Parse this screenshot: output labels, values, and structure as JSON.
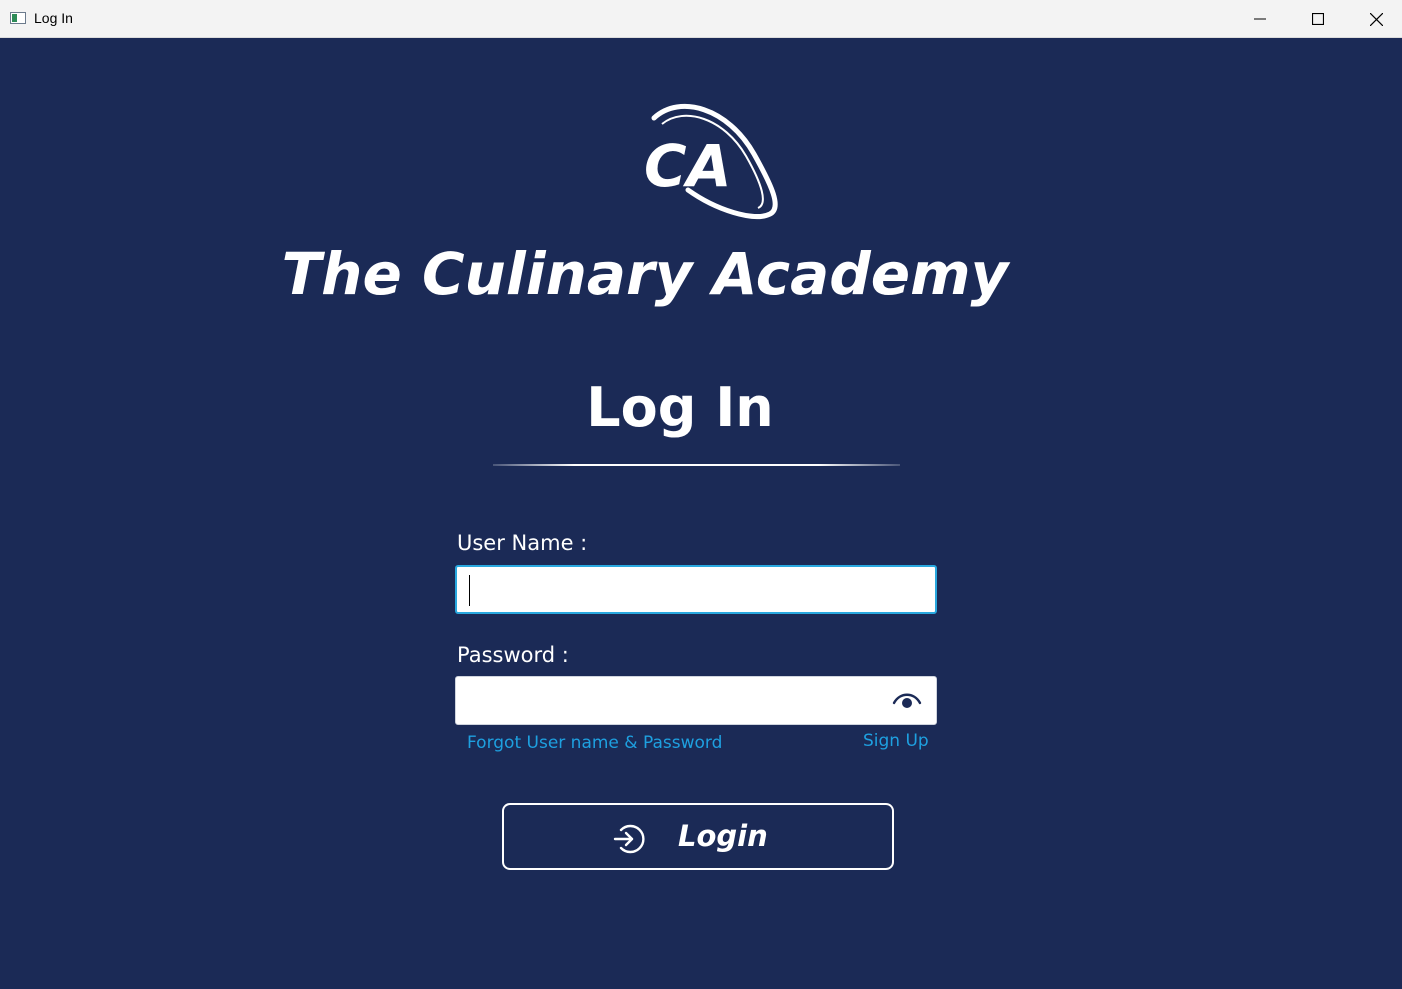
{
  "window": {
    "title": "Log In"
  },
  "brand": {
    "logo_text": "CA",
    "name": "The Culinary Academy"
  },
  "form": {
    "heading": "Log In",
    "username_label": "User Name :",
    "username_value": "",
    "password_label": "Password :",
    "password_value": "",
    "forgot_link": "Forgot User name & Password",
    "signup_link": "Sign Up",
    "login_button": "Login"
  },
  "icons": {
    "app": "app-window-icon",
    "minimize": "minimize-icon",
    "maximize": "maximize-icon",
    "close": "close-icon",
    "show_password": "eye-icon",
    "login": "login-arrow-icon"
  },
  "colors": {
    "background": "#1b2a56",
    "link": "#1ea0e0",
    "focus_border": "#29a8df",
    "text": "#ffffff"
  }
}
